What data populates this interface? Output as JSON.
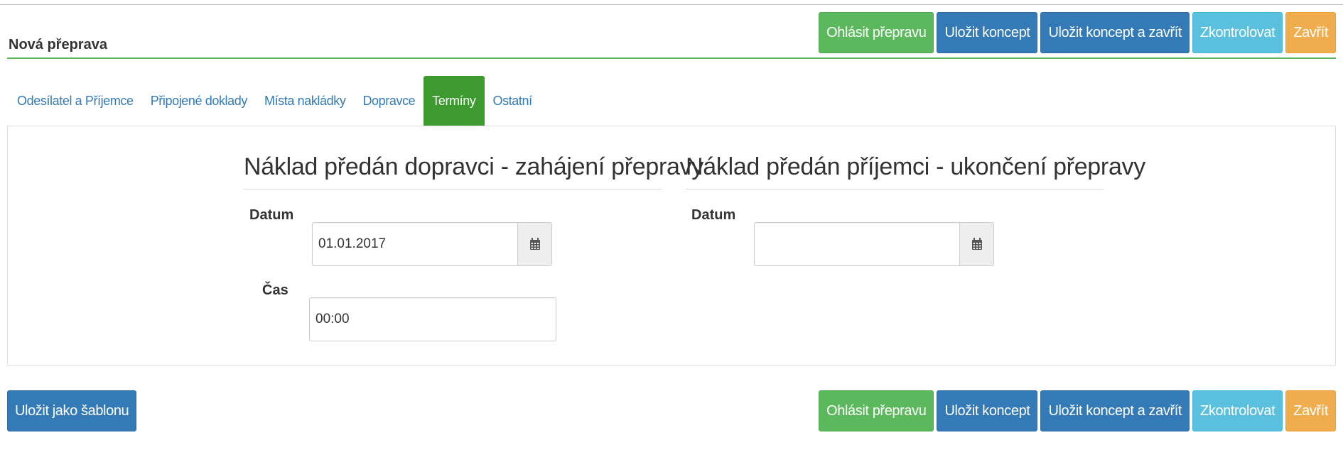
{
  "header": {
    "title": "Nová přeprava",
    "buttons": [
      {
        "label": "Ohlásit přepravu",
        "color": "#5cb85c"
      },
      {
        "label": "Uložit koncept",
        "color": "#337ab7"
      },
      {
        "label": "Uložit koncept a zavřít",
        "color": "#337ab7"
      },
      {
        "label": "Zkontrolovat",
        "color": "#5bc0de"
      },
      {
        "label": "Zavřít",
        "color": "#f0ad4e"
      }
    ]
  },
  "tabs": [
    {
      "label": "Odesílatel a Příjemce",
      "active": false
    },
    {
      "label": "Připojené doklady",
      "active": false
    },
    {
      "label": "Místa nakládky",
      "active": false
    },
    {
      "label": "Dopravce",
      "active": false
    },
    {
      "label": "Termíny",
      "active": true
    },
    {
      "label": "Ostatní",
      "active": false
    }
  ],
  "start_section": {
    "title": "Náklad předán dopravci - zahájení přepravy",
    "date_label": "Datum",
    "date_value": "01.01.2017",
    "time_label": "Čas",
    "time_value": "00:00"
  },
  "end_section": {
    "title": "Náklad předán příjemci - ukončení přepravy",
    "date_label": "Datum",
    "date_value": ""
  },
  "footer": {
    "template_button": "Uložit jako šablonu",
    "buttons": [
      {
        "label": "Ohlásit přepravu"
      },
      {
        "label": "Uložit koncept"
      },
      {
        "label": "Uložit koncept a zavřít"
      },
      {
        "label": "Zkontrolovat"
      },
      {
        "label": "Zavřít"
      }
    ]
  },
  "icons": {
    "date_picker": "calendar-icon"
  },
  "colors": {
    "success": "#5cb85c",
    "primary": "#337ab7",
    "info": "#5bc0de",
    "warning": "#f0ad4e",
    "active_tab": "#3d9a2f"
  }
}
